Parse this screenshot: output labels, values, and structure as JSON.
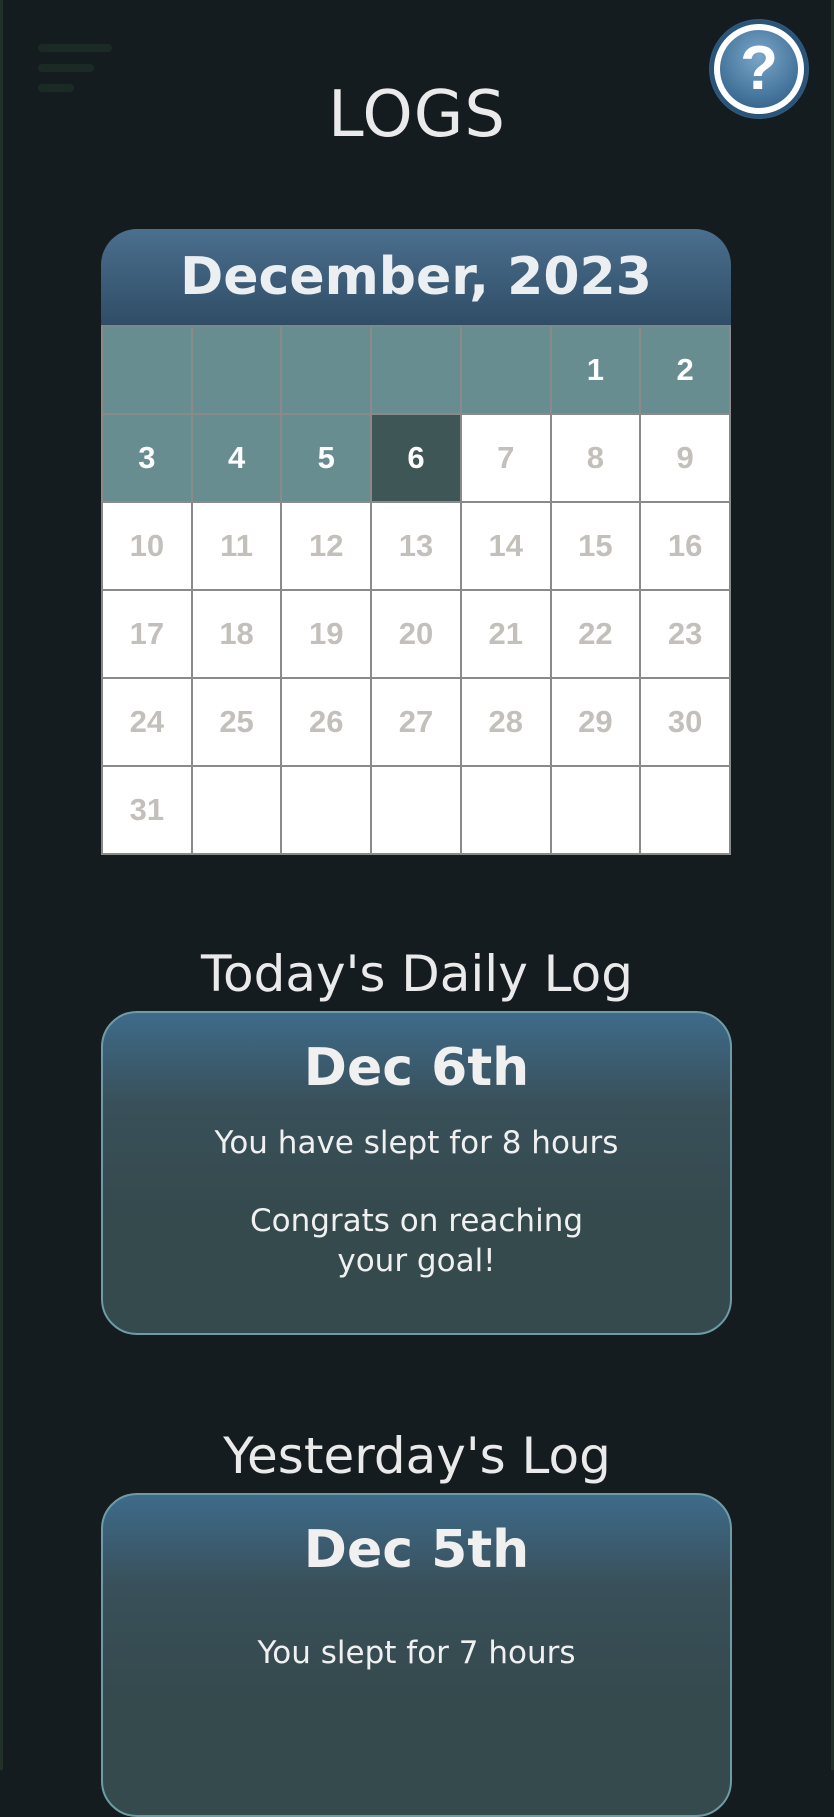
{
  "header": {
    "title": "LOGS",
    "menu_icon": "hamburger-menu-icon",
    "help_icon": "help-circle-icon"
  },
  "calendar": {
    "title": "December, 2023",
    "today": 6,
    "logged_days": [
      1,
      2,
      3,
      4,
      5
    ],
    "cells": [
      "",
      "",
      "",
      "",
      "",
      "1",
      "2",
      "3",
      "4",
      "5",
      "6",
      "7",
      "8",
      "9",
      "10",
      "11",
      "12",
      "13",
      "14",
      "15",
      "16",
      "17",
      "18",
      "19",
      "20",
      "21",
      "22",
      "23",
      "24",
      "25",
      "26",
      "27",
      "28",
      "29",
      "30",
      "31",
      "",
      "",
      "",
      "",
      "",
      ""
    ]
  },
  "today_log": {
    "heading": "Today's Daily Log",
    "date": "Dec 6th",
    "sleep_text": "You have slept for 8 hours",
    "message_line1": "Congrats on reaching",
    "message_line2": "your goal!"
  },
  "yesterday_log": {
    "heading": "Yesterday's Log",
    "date": "Dec 5th",
    "sleep_text": "You slept for 7 hours"
  },
  "colors": {
    "background": "#151c20",
    "accent_blue": "#2f5b80",
    "logged_day": "#678d90",
    "today_day": "#3f5656",
    "card_border": "#6e9ca6"
  }
}
